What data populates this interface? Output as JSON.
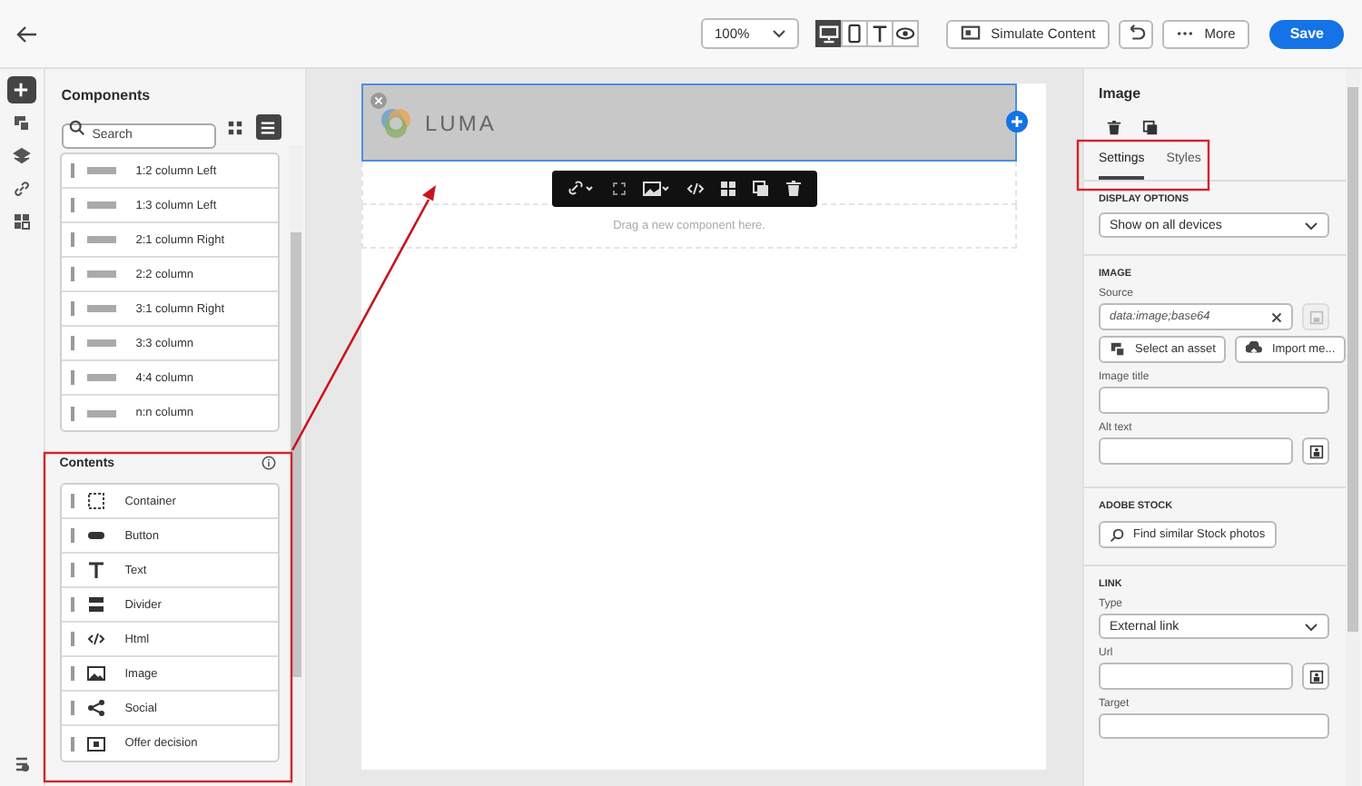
{
  "top_bar": {
    "zoom": "100%",
    "views": [
      {
        "kind": "desktop",
        "selected": true
      },
      {
        "kind": "mobile",
        "selected": false
      },
      {
        "kind": "text",
        "selected": false
      },
      {
        "kind": "preview",
        "selected": false
      }
    ],
    "simulate": "Simulate Content",
    "more": "More",
    "save": "Save"
  },
  "rail": [
    {
      "kind": "add",
      "selected": true
    },
    {
      "kind": "assets",
      "selected": false
    },
    {
      "kind": "layers",
      "selected": false
    },
    {
      "kind": "links",
      "selected": false
    },
    {
      "kind": "fragments",
      "selected": false
    }
  ],
  "components": {
    "title": "Components",
    "search": {
      "placeholder": "Search"
    },
    "views": [
      {
        "kind": "grid",
        "selected": false
      },
      {
        "kind": "list",
        "selected": true
      }
    ],
    "structures": [
      "1:2 column Left",
      "1:3 column Left",
      "2:1 column Right",
      "2:2 column",
      "3:1 column Right",
      "3:3 column",
      "4:4 column",
      "n:n column"
    ],
    "contents_title": "Contents",
    "contents": [
      {
        "kind": "container",
        "label": "Container"
      },
      {
        "kind": "button",
        "label": "Button"
      },
      {
        "kind": "text",
        "label": "Text"
      },
      {
        "kind": "divider",
        "label": "Divider"
      },
      {
        "kind": "html",
        "label": "Html"
      },
      {
        "kind": "image",
        "label": "Image"
      },
      {
        "kind": "social",
        "label": "Social"
      },
      {
        "kind": "offer",
        "label": "Offer decision"
      }
    ]
  },
  "canvas": {
    "logo": "LUMA",
    "drop_hint": "Drag a new component here."
  },
  "properties": {
    "title": "Image",
    "tabs": [
      {
        "label": "Settings",
        "selected": true
      },
      {
        "label": "Styles",
        "selected": false
      }
    ],
    "display_options": {
      "heading": "DISPLAY OPTIONS",
      "value": "Show on all devices"
    },
    "image": {
      "heading": "IMAGE",
      "source_label": "Source",
      "source_value": "data:image;base64",
      "select_asset": "Select an asset",
      "import": "Import me...",
      "title_label": "Image title",
      "alt_label": "Alt text"
    },
    "stock": {
      "heading": "ADOBE STOCK",
      "button": "Find similar Stock photos"
    },
    "link": {
      "heading": "LINK",
      "type_label": "Type",
      "type_value": "External link",
      "url_label": "Url",
      "target_label": "Target"
    }
  }
}
